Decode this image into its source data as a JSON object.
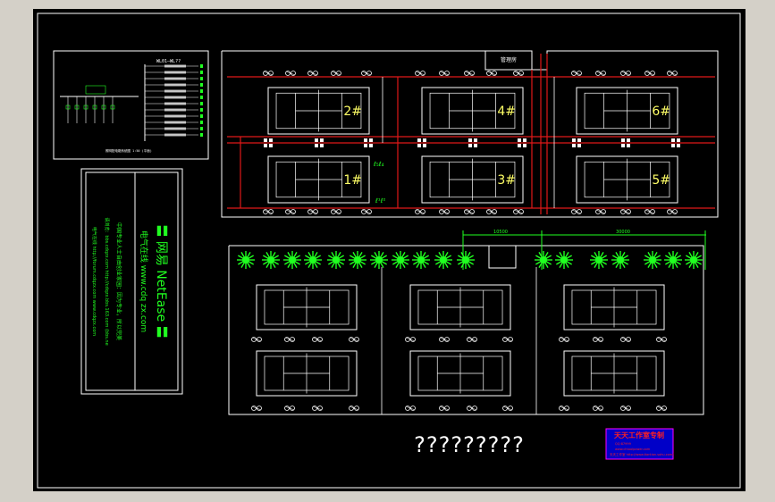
{
  "drawing": {
    "court_labels": [
      "2#",
      "4#",
      "6#",
      "1#",
      "3#",
      "5#"
    ],
    "room_label": "管理房",
    "room_label_small": "管理房",
    "dim_left": "10500",
    "dim_right": "30000",
    "bottom_text": "?????????",
    "schematic_title": "WL01—WL??",
    "schematic_caption": "照明配电箱系统图 1:50 (平面)",
    "banner_main": "〓 网易 NetEase 〓",
    "banner_sub": "电气在线  www.cdq zx.com",
    "banner_line1": "中国专业人士自由创业家园：因为专业，所以完美",
    "banner_line2": "请浏览：bbs.cdqzx.com  http://cdqzx.bbs.163.com  (bbs.ne",
    "banner_line3": "电气在线 http://forum.cdqzx.com  www.cdqzx.com",
    "stamp_title": "天天工作室专制",
    "stamp_line1": "QQ:87999",
    "stamp_line2": "www.chtoolpower.com",
    "stamp_line3": "天天工作室 http://www.tiantian.sohu.com/"
  },
  "colors": {
    "outer_bg": "#d4d0c8",
    "canvas_bg": "#000000",
    "frame": "#ffffff",
    "wire": "#e01818",
    "label": "#ffff66",
    "green": "#20ff20",
    "stamp_fill": "#0000c8",
    "stamp_border": "#ff00ff",
    "stamp_text": "#ff2020"
  }
}
